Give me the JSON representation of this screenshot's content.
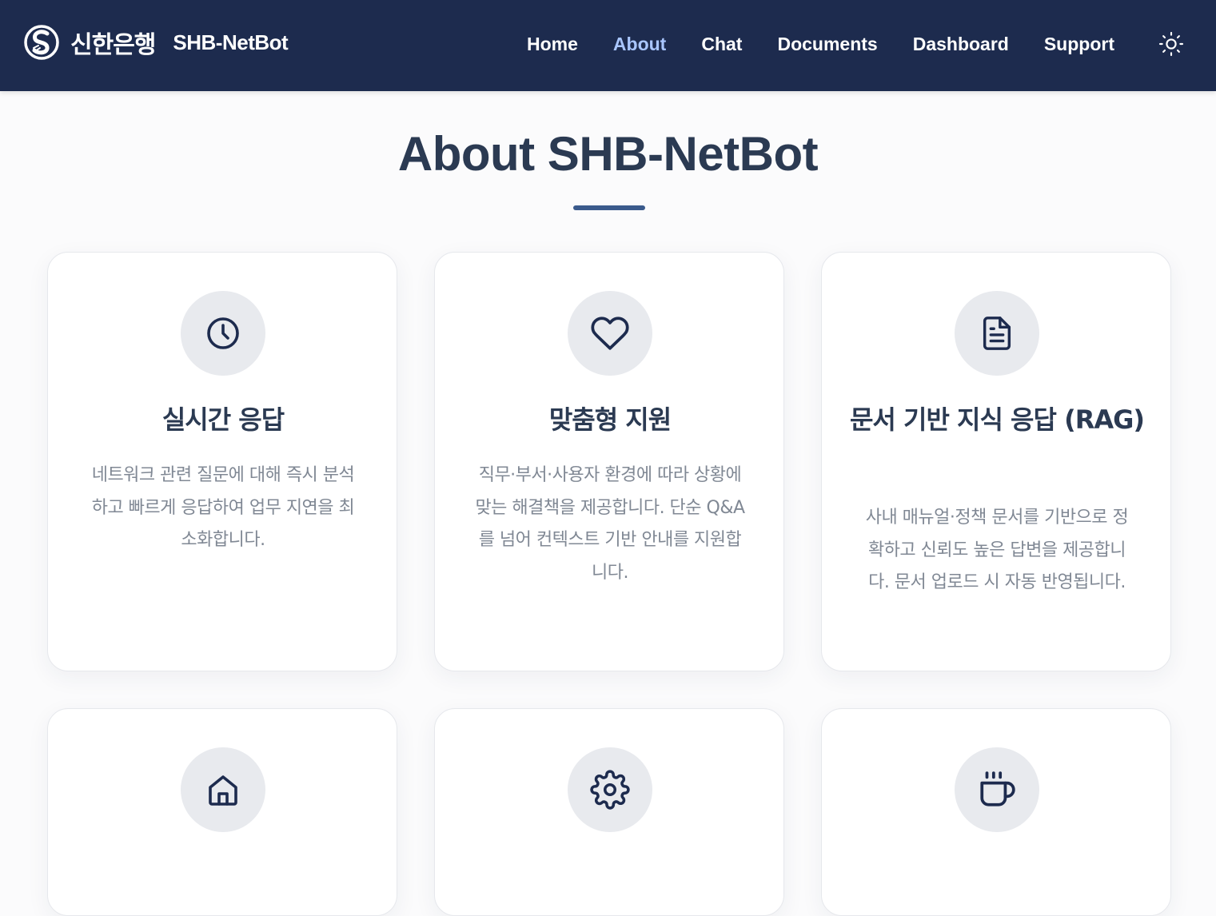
{
  "header": {
    "brand_name": "신한은행",
    "product_name": "SHB-NetBot",
    "nav": [
      {
        "label": "Home",
        "active": false
      },
      {
        "label": "About",
        "active": true
      },
      {
        "label": "Chat",
        "active": false
      },
      {
        "label": "Documents",
        "active": false
      },
      {
        "label": "Dashboard",
        "active": false
      },
      {
        "label": "Support",
        "active": false
      }
    ],
    "theme_icon": "sun-icon"
  },
  "main": {
    "title": "About SHB-NetBot",
    "features": [
      {
        "icon": "clock-icon",
        "title": "실시간 응답",
        "description": "네트워크 관련 질문에 대해 즉시 분석하고 빠르게 응답하여 업무 지연을 최소화합니다."
      },
      {
        "icon": "heart-icon",
        "title": "맞춤형 지원",
        "description": "직무·부서·사용자 환경에 따라 상황에 맞는 해결책을 제공합니다. 단순 Q&A를 넘어 컨텍스트 기반 안내를 지원합니다."
      },
      {
        "icon": "document-icon",
        "title": "문서 기반 지식 응답 (RAG)",
        "description": "사내 매뉴얼·정책 문서를 기반으로 정확하고 신뢰도 높은 답변을 제공합니다. 문서 업로드 시 자동 반영됩니다."
      },
      {
        "icon": "home-icon",
        "title": "",
        "description": ""
      },
      {
        "icon": "gear-icon",
        "title": "",
        "description": ""
      },
      {
        "icon": "coffee-icon",
        "title": "",
        "description": ""
      }
    ]
  },
  "colors": {
    "navbar_bg": "#1d2b4e",
    "nav_active": "#a9c6ff",
    "title_text": "#2b3a52",
    "accent_divider": "#3a5a8c",
    "icon_circle_bg": "#e8eaee",
    "icon_stroke": "#1d2b4e",
    "desc_text": "#808894"
  }
}
